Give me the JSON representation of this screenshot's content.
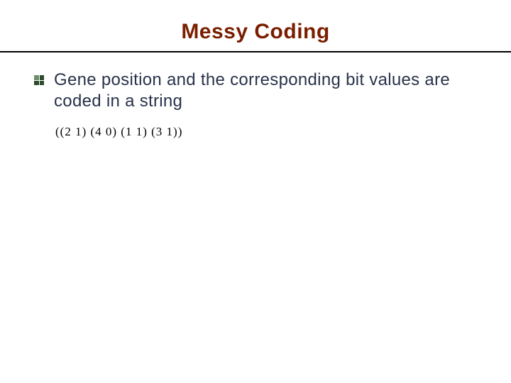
{
  "title": "Messy Coding",
  "bullets": [
    {
      "text": "Gene position and the corresponding bit values are coded in a string"
    }
  ],
  "code_example": "((2 1)  (4 0)  (1 1)  (3 1))"
}
